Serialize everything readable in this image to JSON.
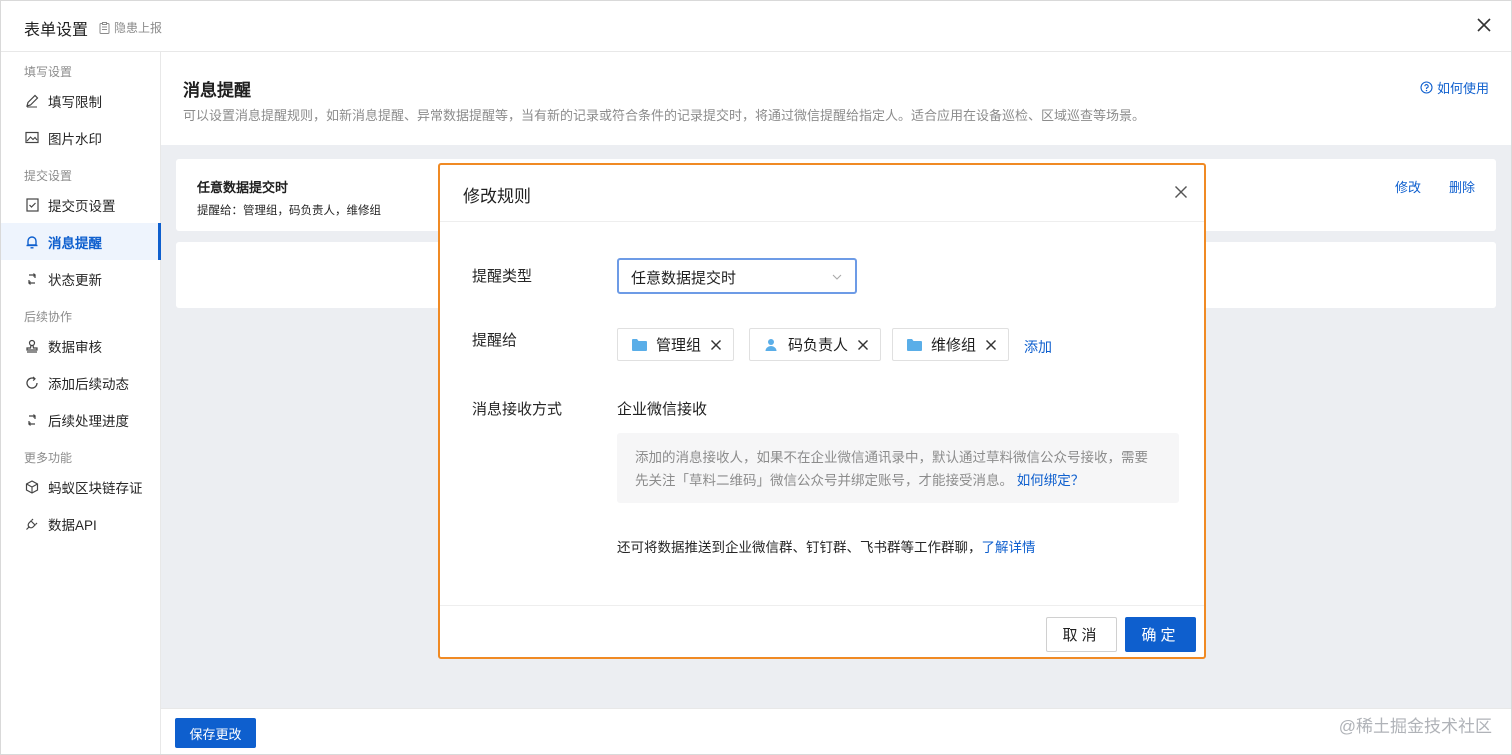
{
  "window": {
    "title": "表单设置",
    "report_label": "隐患上报"
  },
  "sidebar": {
    "groups": [
      {
        "title": "填写设置",
        "items": [
          {
            "label": "填写限制",
            "icon": "pencil-icon"
          },
          {
            "label": "图片水印",
            "icon": "image-icon"
          }
        ]
      },
      {
        "title": "提交设置",
        "items": [
          {
            "label": "提交页设置",
            "icon": "form-check-icon"
          },
          {
            "label": "消息提醒",
            "icon": "bell-icon",
            "active": true
          },
          {
            "label": "状态更新",
            "icon": "refresh-icon"
          }
        ]
      },
      {
        "title": "后续协作",
        "items": [
          {
            "label": "数据审核",
            "icon": "stamp-icon"
          },
          {
            "label": "添加后续动态",
            "icon": "loop-icon"
          },
          {
            "label": "后续处理进度",
            "icon": "refresh-icon"
          }
        ]
      },
      {
        "title": "更多功能",
        "items": [
          {
            "label": "蚂蚁区块链存证",
            "icon": "cube-icon"
          },
          {
            "label": "数据API",
            "icon": "plug-icon"
          }
        ]
      }
    ]
  },
  "header": {
    "title": "消息提醒",
    "description": "可以设置消息提醒规则，如新消息提醒、异常数据提醒等，当有新的记录或符合条件的记录提交时，将通过微信提醒给指定人。适合应用在设备巡检、区域巡查等场景。",
    "help_label": "如何使用"
  },
  "rule": {
    "title": "任意数据提交时",
    "summary": "提醒给：管理组，码负责人，维修组",
    "edit_label": "修改",
    "delete_label": "删除"
  },
  "footer": {
    "save_label": "保存更改"
  },
  "watermark": "@稀土掘金技术社区",
  "modal": {
    "title": "修改规则",
    "type_label": "提醒类型",
    "type_value": "任意数据提交时",
    "remind_label": "提醒给",
    "recipients": [
      {
        "name": "管理组",
        "icon": "folder-icon"
      },
      {
        "name": "码负责人",
        "icon": "person-icon"
      },
      {
        "name": "维修组",
        "icon": "folder-icon"
      }
    ],
    "add_label": "添加",
    "receive_label": "消息接收方式",
    "receive_value": "企业微信接收",
    "notice_text": "添加的消息接收人，如果不在企业微信通讯录中，默认通过草料微信公众号接收，需要先关注「草料二维码」微信公众号并绑定账号，才能接受消息。",
    "notice_link": "如何绑定？",
    "push_text": "还可将数据推送到企业微信群、钉钉群、飞书群等工作群聊，",
    "push_link": "了解详情",
    "cancel_label": "取消",
    "ok_label": "确定"
  },
  "colors": {
    "primary": "#0e5fce",
    "modal_border": "#f08a24",
    "folder": "#5aaee8"
  }
}
